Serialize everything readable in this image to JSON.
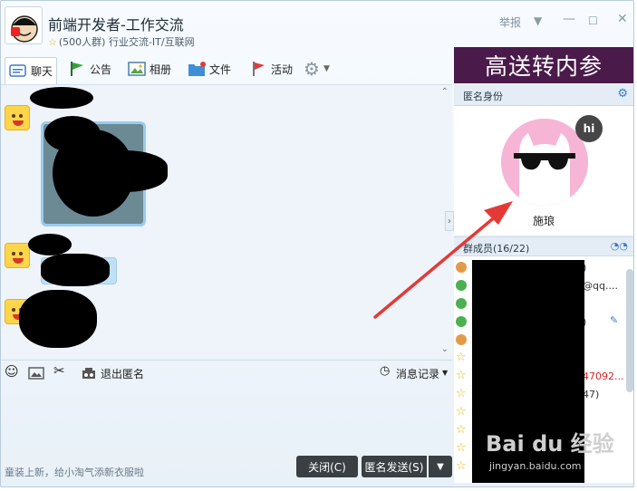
{
  "header": {
    "title": "前端开发者-工作交流",
    "subtitle": "(500人群) 行业交流-IT/互联网",
    "report_label": "举报"
  },
  "toolbar": {
    "items": [
      {
        "label": "聊天",
        "icon": "chat-icon"
      },
      {
        "label": "公告",
        "icon": "flag-icon"
      },
      {
        "label": "相册",
        "icon": "photo-album-icon"
      },
      {
        "label": "文件",
        "icon": "folder-icon"
      },
      {
        "label": "活动",
        "icon": "activity-flag-icon"
      }
    ]
  },
  "input_bar": {
    "exit_anonymous": "退出匿名",
    "history": "消息记录"
  },
  "footer": {
    "hint": "童装上新，给小淘气添新衣服啦",
    "close": "关闭(C)",
    "send": "匿名发送(S)"
  },
  "right_panel": {
    "ad_text": "高送转内参",
    "anonymous_title": "匿名身份",
    "anonymous_name": "施琅",
    "hi_badge": "hi",
    "members_title": "群成员(16/22)",
    "member_snippets": [
      {
        "text": ")",
        "color": "normal"
      },
      {
        "text": "@qq....",
        "color": "normal"
      },
      {
        "text": "",
        "color": "normal"
      },
      {
        "text": ")",
        "color": "normal"
      },
      {
        "text": "",
        "color": "normal"
      },
      {
        "text": "",
        "color": "normal"
      },
      {
        "text": "47092...",
        "color": "red"
      },
      {
        "text": "47)",
        "color": "normal"
      }
    ]
  },
  "watermark": {
    "logo": "Bai du 经验",
    "url": "jingyan.baidu.com"
  },
  "colors": {
    "accent": "#3a7ccc",
    "ad_bg": "#4a1b4a",
    "arrow": "#e53935",
    "avatar_bg": "#f7b5d6"
  }
}
